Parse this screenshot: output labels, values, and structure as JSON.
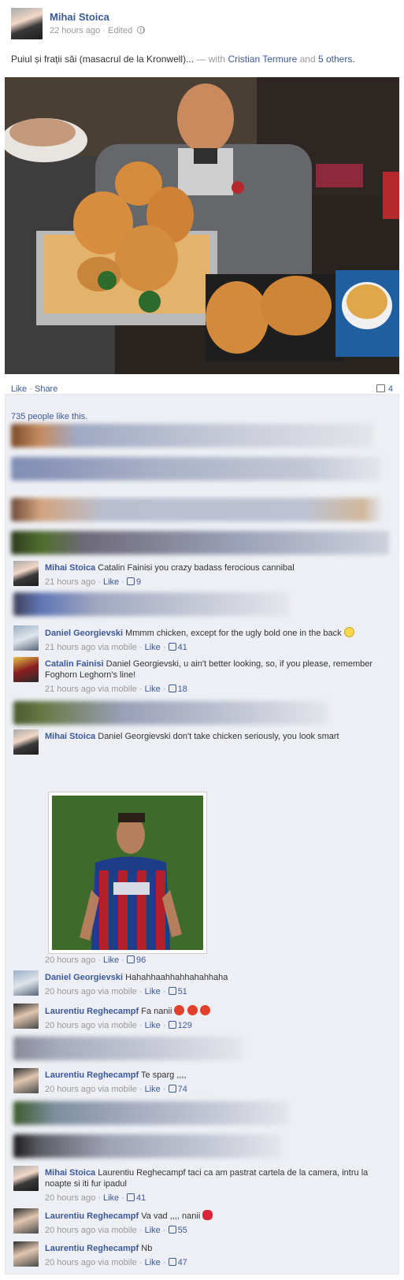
{
  "post": {
    "author": "Mihai Stoica",
    "time": "22 hours ago",
    "edited": "Edited",
    "text": "Puiul și frații săi (masacrul de la Kronwell)...",
    "dash": "—",
    "with_label": "with",
    "tagged": "Cristian Termure",
    "and_label": "and",
    "others": "5 others",
    "period": "."
  },
  "actions": {
    "like": "Like",
    "dot": "·",
    "share": "Share",
    "comment_count": "4"
  },
  "likes_text": "735 people like this.",
  "comments": [
    {
      "name": "Mihai Stoica",
      "text": "Catalin Fainisi you crazy badass ferocious cannibal",
      "time": "21 hours ago",
      "via": "",
      "like": "Like",
      "count": "9"
    },
    {
      "name": "Daniel Georgievski",
      "text": "Mmmm chicken, except for the ugly bold one in the back",
      "time": "21 hours ago",
      "via": "via mobile",
      "like": "Like",
      "count": "41"
    },
    {
      "name": "Catalin Fainisi",
      "text": "Daniel Georgievski, u ain't better looking, so, if you please, remember Foghorn Leghorn's line!",
      "time": "21 hours ago",
      "via": "via mobile",
      "like": "Like",
      "count": "18"
    },
    {
      "name": "Mihai Stoica",
      "text": "Daniel Georgievski don't take chicken seriously, you look smart",
      "time": "20 hours ago",
      "via": "",
      "like": "Like",
      "count": "96"
    },
    {
      "name": "Daniel Georgievski",
      "text": "Hahahhaahhahhahahhaha",
      "time": "20 hours ago",
      "via": "via mobile",
      "like": "Like",
      "count": "51"
    },
    {
      "name": "Laurentiu Reghecampf",
      "text": "Fa nanii",
      "time": "20 hours ago",
      "via": "via mobile",
      "like": "Like",
      "count": "129"
    },
    {
      "name": "Laurentiu Reghecampf",
      "text": "Te sparg ,,,,",
      "time": "20 hours ago",
      "via": "via mobile",
      "like": "Like",
      "count": "74"
    },
    {
      "name": "Mihai Stoica",
      "text": "Laurentiu Reghecampf taci ca am pastrat cartela de la camera, intru la noapte si iti fur ipadul",
      "time": "20 hours ago",
      "via": "",
      "like": "Like",
      "count": "41"
    },
    {
      "name": "Laurentiu Reghecampf",
      "text": "Va vad ,,,, nanii",
      "time": "20 hours ago",
      "via": "via mobile",
      "like": "Like",
      "count": "55"
    },
    {
      "name": "Laurentiu Reghecampf",
      "text": "Nb",
      "time": "20 hours ago",
      "via": "via mobile",
      "like": "Like",
      "count": "47"
    }
  ],
  "colors": {
    "link": "#3b5998",
    "ufi_bg": "#edeff4",
    "muted": "#999999"
  }
}
